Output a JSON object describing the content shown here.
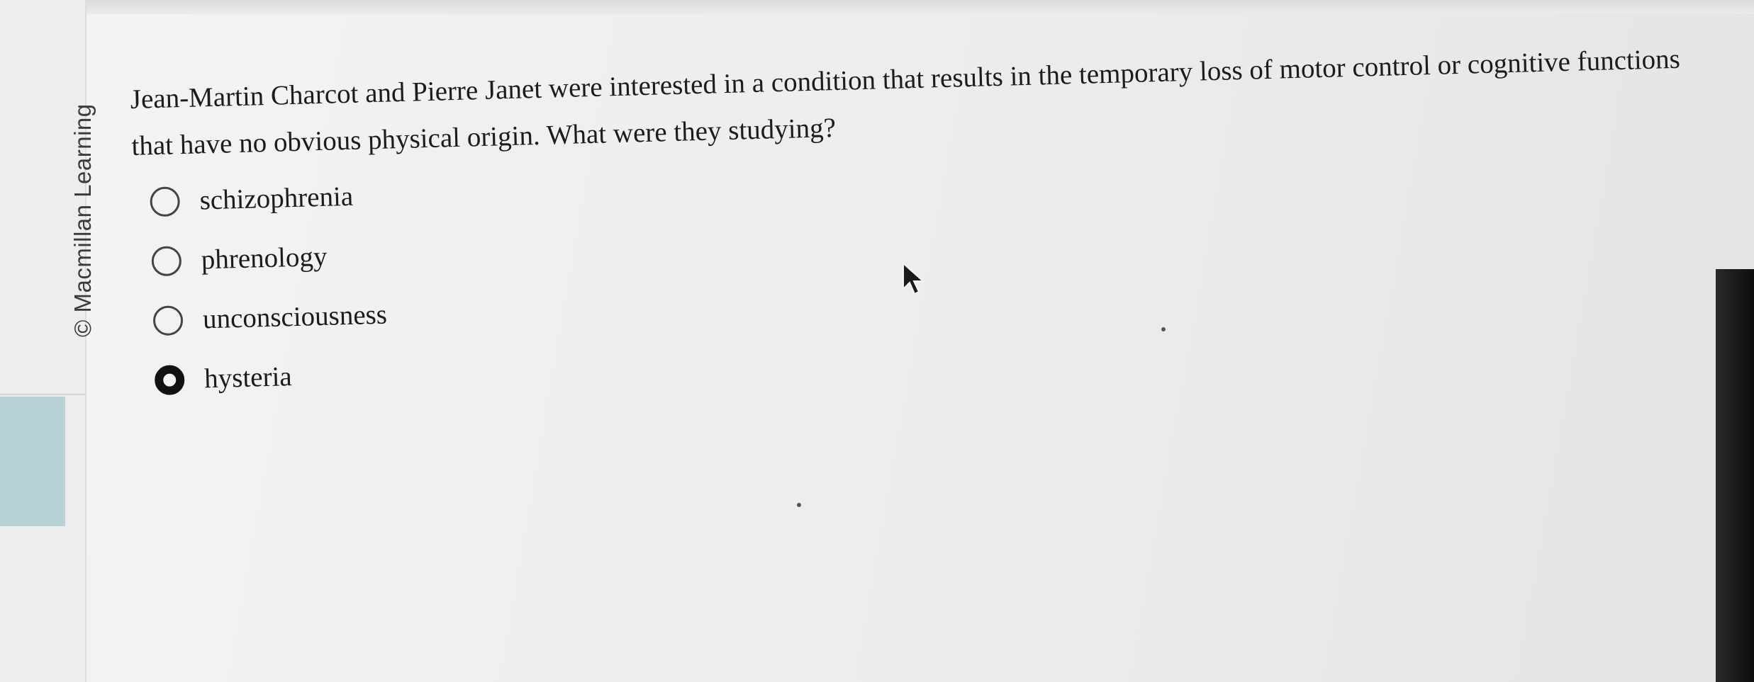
{
  "watermark": {
    "text": "© Macmillan Learning"
  },
  "question": {
    "text": "Jean-Martin Charcot and Pierre Janet were interested in a condition that results in the temporary loss of motor control or cognitive functions that have no obvious physical origin. What were they studying?"
  },
  "options": [
    {
      "label": "schizophrenia",
      "selected": false
    },
    {
      "label": "phrenology",
      "selected": false
    },
    {
      "label": "unconsciousness",
      "selected": false
    },
    {
      "label": "hysteria",
      "selected": true
    }
  ],
  "icons": {
    "cursor": "mouse-pointer-icon",
    "radio": "radio-button-icon"
  },
  "colors": {
    "background": "#efefed",
    "text": "#1c1c1c",
    "left_panel_tint": "#b8d3d6"
  }
}
